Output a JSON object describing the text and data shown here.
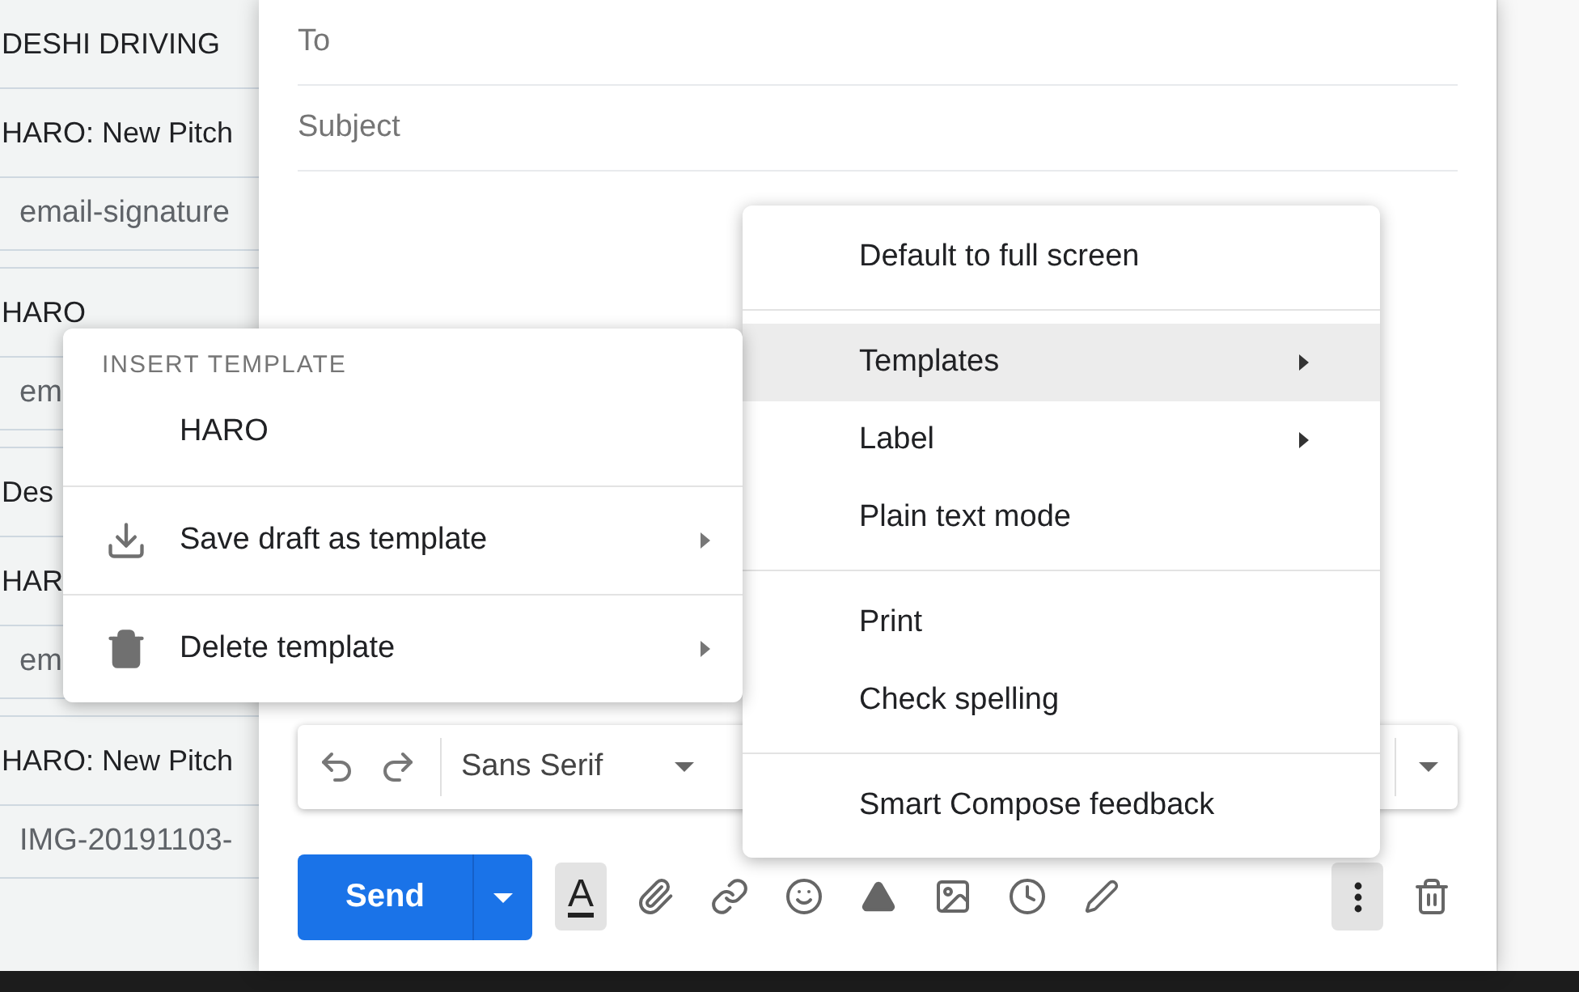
{
  "message_list": [
    {
      "kind": "subject",
      "text": "DESHI DRIVING"
    },
    {
      "kind": "subject",
      "text": "HARO: New Pitch"
    },
    {
      "kind": "attachment",
      "text": "email-signature"
    },
    {
      "kind": "gap"
    },
    {
      "kind": "subject",
      "text": "HARO"
    },
    {
      "kind": "attachment",
      "text": "em"
    },
    {
      "kind": "gap"
    },
    {
      "kind": "subject",
      "text": "Des"
    },
    {
      "kind": "subject",
      "text": "HAR"
    },
    {
      "kind": "attachment",
      "text": "em"
    },
    {
      "kind": "gap"
    },
    {
      "kind": "subject",
      "text": "HARO: New Pitch"
    },
    {
      "kind": "attachment",
      "text": "IMG-20191103-"
    }
  ],
  "compose": {
    "to": {
      "placeholder": "To"
    },
    "subject": {
      "placeholder": "Subject"
    },
    "format_bar": {
      "font": "Sans Serif"
    },
    "send": "Send",
    "text_format_label": "A",
    "formatting_selected": true,
    "more_selected": true
  },
  "more_menu": [
    {
      "kind": "item",
      "label": "Default to full screen",
      "submenu": false,
      "selected": false
    },
    {
      "kind": "divider"
    },
    {
      "kind": "item",
      "label": "Templates",
      "submenu": true,
      "selected": true
    },
    {
      "kind": "item",
      "label": "Label",
      "submenu": true,
      "selected": false
    },
    {
      "kind": "item",
      "label": "Plain text mode",
      "submenu": false,
      "selected": false
    },
    {
      "kind": "divider"
    },
    {
      "kind": "item",
      "label": "Print",
      "submenu": false,
      "selected": false
    },
    {
      "kind": "item",
      "label": "Check spelling",
      "submenu": false,
      "selected": false
    },
    {
      "kind": "divider"
    },
    {
      "kind": "item",
      "label": "Smart Compose feedback",
      "submenu": false,
      "selected": false
    }
  ],
  "templates_menu": [
    {
      "kind": "header",
      "label": "INSERT TEMPLATE"
    },
    {
      "kind": "template",
      "label": "HARO",
      "submenu": false
    },
    {
      "kind": "divider"
    },
    {
      "kind": "save",
      "label": "Save draft as template",
      "submenu": true
    },
    {
      "kind": "divider"
    },
    {
      "kind": "delete",
      "label": "Delete template",
      "submenu": true
    }
  ]
}
